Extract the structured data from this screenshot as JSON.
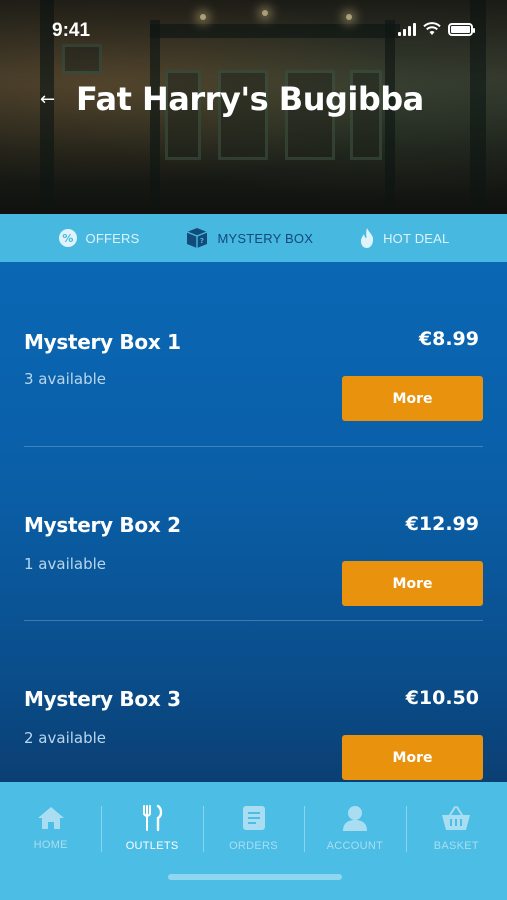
{
  "status_bar": {
    "time": "9:41"
  },
  "header": {
    "back_glyph": "←",
    "title": "Fat Harry's Bugibba"
  },
  "tabs": [
    {
      "label": "OFFERS",
      "icon": "offers-badge-icon",
      "active": false
    },
    {
      "label": "MYSTERY BOX",
      "icon": "mystery-box-icon",
      "active": true
    },
    {
      "label": "HOT DEAL",
      "icon": "flame-icon",
      "active": false
    }
  ],
  "items": [
    {
      "name": "Mystery Box 1",
      "availability": "3 available",
      "price": "€8.99",
      "button": "More"
    },
    {
      "name": "Mystery Box 2",
      "availability": "1 available",
      "price": "€12.99",
      "button": "More"
    },
    {
      "name": "Mystery Box 3",
      "availability": "2 available",
      "price": "€10.50",
      "button": "More"
    }
  ],
  "bottom_nav": [
    {
      "label": "HOME",
      "icon": "home-icon",
      "active": false
    },
    {
      "label": "OUTLETS",
      "icon": "fork-knife-icon",
      "active": true
    },
    {
      "label": "ORDERS",
      "icon": "orders-list-icon",
      "active": false
    },
    {
      "label": "ACCOUNT",
      "icon": "user-icon",
      "active": false
    },
    {
      "label": "BASKET",
      "icon": "basket-icon",
      "active": false
    }
  ],
  "colors": {
    "tab_bar": "#47b8e0",
    "active_tab": "#124a7a",
    "list_background": "#0a67b4",
    "button": "#e8920e",
    "bottom_nav": "#4cbde4"
  }
}
